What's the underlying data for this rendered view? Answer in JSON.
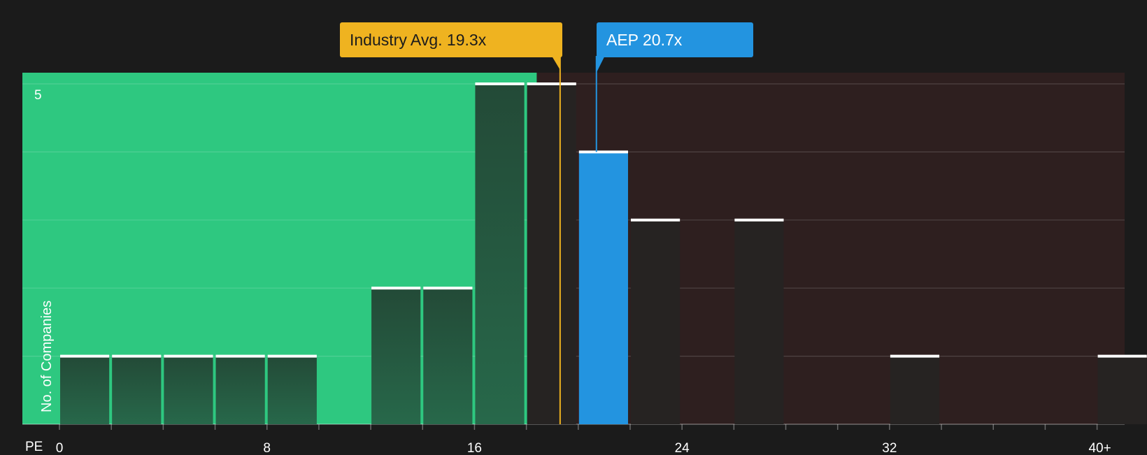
{
  "chart_data": {
    "type": "bar",
    "xlabel": "PE",
    "ylabel": "No. of Companies",
    "x_ticks": [
      0,
      8,
      16,
      24,
      32,
      40
    ],
    "x_tick_labels": [
      "0",
      "8",
      "16",
      "24",
      "32",
      "40+"
    ],
    "xlim": [
      0,
      40
    ],
    "ylim": [
      0,
      5
    ],
    "y_tick_label": "5",
    "bin_width": 2,
    "bins": [
      {
        "start": 0,
        "count": 1
      },
      {
        "start": 2,
        "count": 1
      },
      {
        "start": 4,
        "count": 1
      },
      {
        "start": 6,
        "count": 1
      },
      {
        "start": 8,
        "count": 1
      },
      {
        "start": 12,
        "count": 2
      },
      {
        "start": 14,
        "count": 2
      },
      {
        "start": 16,
        "count": 5
      },
      {
        "start": 18,
        "count": 5
      },
      {
        "start": 20,
        "count": 4,
        "highlight": true
      },
      {
        "start": 22,
        "count": 3
      },
      {
        "start": 26,
        "count": 3
      },
      {
        "start": 32,
        "count": 1
      },
      {
        "start": 40,
        "count": 1
      }
    ],
    "industry_avg": {
      "label": "Industry Avg. 19.3x",
      "value": 19.3
    },
    "company": {
      "label": "AEP 20.7x",
      "value": 20.7
    },
    "fair_zone_end": 18.4,
    "grid": true
  },
  "colors": {
    "background": "#1b1b1b",
    "good_zone": "#2ec880",
    "bad_zone": "#2e1f1f",
    "bar_dark": "#234a37",
    "bar_light": "#27684a",
    "bar_over": "#262322",
    "highlight": "#2394e0",
    "industry": "#efb320"
  }
}
